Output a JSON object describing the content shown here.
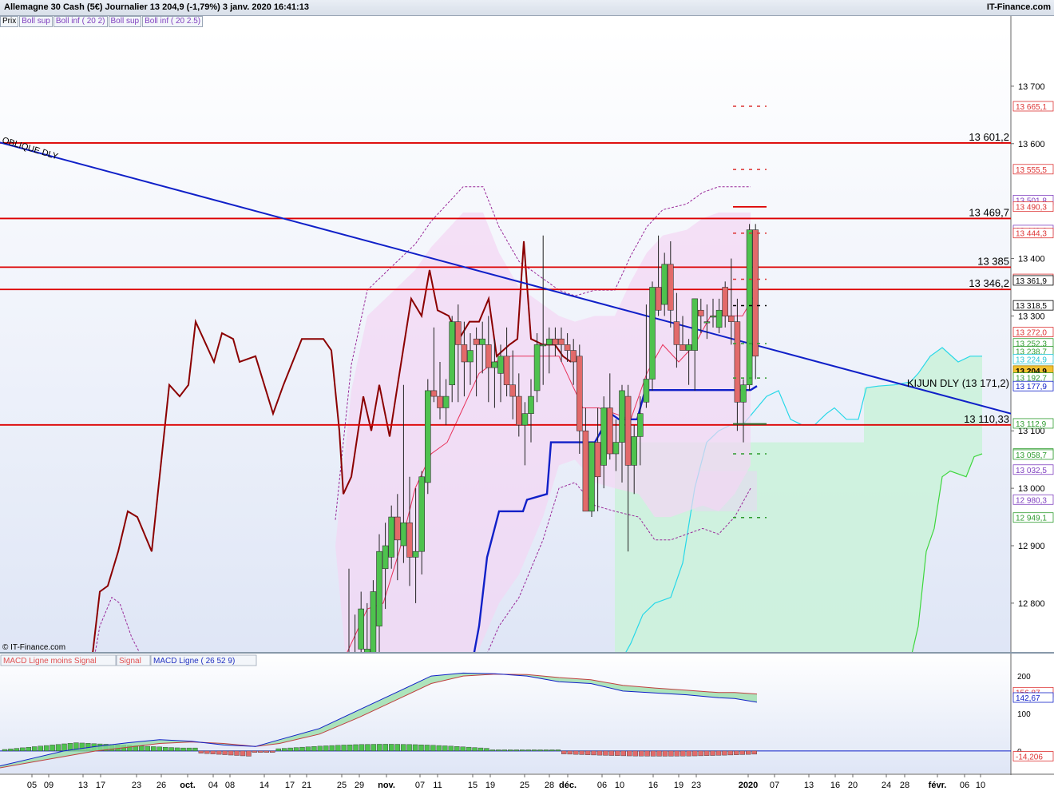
{
  "header": {
    "title": "Allemagne 30 Cash (5€)   Journalier   13 204,9 (-1,79%)   3 janv. 2020 16:41:13",
    "brand": "IT-Finance.com"
  },
  "legend": [
    {
      "label": "Prix",
      "color": "#000000"
    },
    {
      "label": "Boll sup",
      "color": "#7f3fbf"
    },
    {
      "label": "Boll inf ( 20 2)",
      "color": "#7f3fbf"
    },
    {
      "label": "Boll sup",
      "color": "#7f3fbf"
    },
    {
      "label": "Boll inf ( 20 2.5)",
      "color": "#7f3fbf"
    }
  ],
  "watermark": "© IT-Finance.com",
  "macd_legend": [
    {
      "label": "MACD Ligne moins Signal",
      "color": "#e05050"
    },
    {
      "label": "Signal",
      "color": "#e05050"
    },
    {
      "label": "MACD Ligne ( 26 52 9)",
      "color": "#2030c0"
    }
  ],
  "colors": {
    "up": "#4ec24e",
    "down": "#e26a6a",
    "resistance": "#dd0000",
    "oblique": "#1020c8",
    "kijun": "#1020c8",
    "close_line": "#8b0000",
    "cloud_fill": "#ccf2dc",
    "boll_fill": "#f3d6f3"
  },
  "chart_data": [
    {
      "type": "candlestick",
      "title": "Allemagne 30 Cash (5€)",
      "ylim": [
        12715,
        13800
      ],
      "y_ticks": [
        "13 700",
        "13 600",
        "13 400",
        "13 300",
        "13 100",
        "13 000",
        "12 900",
        "12 800"
      ],
      "x_ticks": [
        "05",
        "09",
        "13",
        "17",
        "23",
        "26",
        "oct.",
        "04",
        "08",
        "14",
        "17",
        "21",
        "25",
        "29",
        "nov.",
        "07",
        "11",
        "15",
        "19",
        "25",
        "28",
        "déc.",
        "06",
        "10",
        "16",
        "19",
        "23",
        "2020",
        "07",
        "13",
        "16",
        "20",
        "24",
        "28",
        "févr.",
        "06",
        "10"
      ],
      "candles": [
        {
          "o": 12640,
          "h": 12860,
          "l": 12560,
          "c": 12700
        },
        {
          "o": 12680,
          "h": 12780,
          "l": 12580,
          "c": 12710
        },
        {
          "o": 12720,
          "h": 12820,
          "l": 12650,
          "c": 12790
        },
        {
          "o": 12710,
          "h": 12800,
          "l": 12640,
          "c": 12720
        },
        {
          "o": 12700,
          "h": 12840,
          "l": 12650,
          "c": 12820
        },
        {
          "o": 12760,
          "h": 12920,
          "l": 12700,
          "c": 12890
        },
        {
          "o": 12860,
          "h": 12940,
          "l": 12790,
          "c": 12900
        },
        {
          "o": 12880,
          "h": 12970,
          "l": 12860,
          "c": 12950
        },
        {
          "o": 12950,
          "h": 12990,
          "l": 12840,
          "c": 12910
        },
        {
          "o": 12900,
          "h": 13180,
          "l": 12870,
          "c": 12940
        },
        {
          "o": 12940,
          "h": 13020,
          "l": 12830,
          "c": 12880
        },
        {
          "o": 12880,
          "h": 13000,
          "l": 12800,
          "c": 12890
        },
        {
          "o": 12890,
          "h": 13030,
          "l": 12850,
          "c": 13020
        },
        {
          "o": 13010,
          "h": 13190,
          "l": 12990,
          "c": 13170
        },
        {
          "o": 13170,
          "h": 13280,
          "l": 13150,
          "c": 13160
        },
        {
          "o": 13160,
          "h": 13220,
          "l": 13120,
          "c": 13140
        },
        {
          "o": 13140,
          "h": 13190,
          "l": 13110,
          "c": 13160
        },
        {
          "o": 13180,
          "h": 13300,
          "l": 13150,
          "c": 13290
        },
        {
          "o": 13290,
          "h": 13320,
          "l": 13150,
          "c": 13250
        },
        {
          "o": 13250,
          "h": 13290,
          "l": 13160,
          "c": 13220
        },
        {
          "o": 13220,
          "h": 13270,
          "l": 13180,
          "c": 13240
        },
        {
          "o": 13260,
          "h": 13280,
          "l": 13160,
          "c": 13250
        },
        {
          "o": 13250,
          "h": 13290,
          "l": 13200,
          "c": 13260
        },
        {
          "o": 13250,
          "h": 13300,
          "l": 13150,
          "c": 13210
        },
        {
          "o": 13210,
          "h": 13260,
          "l": 13140,
          "c": 13220
        },
        {
          "o": 13200,
          "h": 13250,
          "l": 13150,
          "c": 13230
        },
        {
          "o": 13230,
          "h": 13280,
          "l": 13160,
          "c": 13180
        },
        {
          "o": 13180,
          "h": 13240,
          "l": 13120,
          "c": 13160
        },
        {
          "o": 13160,
          "h": 13200,
          "l": 13090,
          "c": 13110
        },
        {
          "o": 13110,
          "h": 13150,
          "l": 13040,
          "c": 13130
        },
        {
          "o": 13130,
          "h": 13190,
          "l": 13080,
          "c": 13160
        },
        {
          "o": 13170,
          "h": 13270,
          "l": 13150,
          "c": 13250
        },
        {
          "o": 13250,
          "h": 13440,
          "l": 13180,
          "c": 13250
        },
        {
          "o": 13250,
          "h": 13280,
          "l": 13200,
          "c": 13260
        },
        {
          "o": 13260,
          "h": 13280,
          "l": 13230,
          "c": 13250
        },
        {
          "o": 13260,
          "h": 13280,
          "l": 13220,
          "c": 13250
        },
        {
          "o": 13250,
          "h": 13270,
          "l": 13220,
          "c": 13240
        },
        {
          "o": 13240,
          "h": 13260,
          "l": 13180,
          "c": 13220
        },
        {
          "o": 13230,
          "h": 13250,
          "l": 13060,
          "c": 13100
        },
        {
          "o": 13100,
          "h": 13140,
          "l": 13000,
          "c": 12960
        },
        {
          "o": 12960,
          "h": 13050,
          "l": 12950,
          "c": 13080
        },
        {
          "o": 13080,
          "h": 13140,
          "l": 12960,
          "c": 13020
        },
        {
          "o": 13040,
          "h": 13160,
          "l": 13000,
          "c": 13140
        },
        {
          "o": 13140,
          "h": 13200,
          "l": 13050,
          "c": 13060
        },
        {
          "o": 13060,
          "h": 13120,
          "l": 13030,
          "c": 13080
        },
        {
          "o": 13080,
          "h": 13180,
          "l": 13010,
          "c": 13170
        },
        {
          "o": 13160,
          "h": 13180,
          "l": 12890,
          "c": 13040
        },
        {
          "o": 13040,
          "h": 13110,
          "l": 12990,
          "c": 13090
        },
        {
          "o": 13090,
          "h": 13160,
          "l": 13040,
          "c": 13130
        },
        {
          "o": 13150,
          "h": 13320,
          "l": 13140,
          "c": 13190
        },
        {
          "o": 13190,
          "h": 13360,
          "l": 13170,
          "c": 13350
        },
        {
          "o": 13350,
          "h": 13440,
          "l": 13300,
          "c": 13310
        },
        {
          "o": 13320,
          "h": 13410,
          "l": 13300,
          "c": 13390
        },
        {
          "o": 13390,
          "h": 13430,
          "l": 13280,
          "c": 13310
        },
        {
          "o": 13290,
          "h": 13340,
          "l": 13210,
          "c": 13250
        },
        {
          "o": 13250,
          "h": 13300,
          "l": 13240,
          "c": 13240
        },
        {
          "o": 13240,
          "h": 13260,
          "l": 13180,
          "c": 13250
        },
        {
          "o": 13240,
          "h": 13330,
          "l": 13170,
          "c": 13330
        },
        {
          "o": 13310,
          "h": 13330,
          "l": 13270,
          "c": 13300
        },
        {
          "o": 13290,
          "h": 13320,
          "l": 13260,
          "c": 13290
        },
        {
          "o": 13300,
          "h": 13330,
          "l": 13280,
          "c": 13300
        },
        {
          "o": 13280,
          "h": 13330,
          "l": 13270,
          "c": 13310
        },
        {
          "o": 13350,
          "h": 13360,
          "l": 13280,
          "c": 13300
        },
        {
          "o": 13300,
          "h": 13400,
          "l": 13250,
          "c": 13290
        },
        {
          "o": 13290,
          "h": 13330,
          "l": 13100,
          "c": 13150
        },
        {
          "o": 13150,
          "h": 13190,
          "l": 13080,
          "c": 13180
        },
        {
          "o": 13180,
          "h": 13460,
          "l": 13170,
          "c": 13450
        },
        {
          "o": 13450,
          "h": 13460,
          "l": 13190,
          "c": 13230
        }
      ],
      "resistance_levels": [
        {
          "value": 13601.2,
          "label": "13 601,2"
        },
        {
          "value": 13469.7,
          "label": "13 469,7"
        },
        {
          "value": 13385,
          "label": "13 385"
        },
        {
          "value": 13346.2,
          "label": "13 346,2"
        },
        {
          "value": 13110.33,
          "label": "13 110,33"
        }
      ],
      "annotations": {
        "oblique": "OBLIQUE DLY",
        "kijun": "KIJUN DLY (13 171,2)",
        "kijun_value": 13171.2
      },
      "right_labels": [
        {
          "value": 13665.1,
          "label": "13 665,1",
          "color": "#dd3333"
        },
        {
          "value": 13555.5,
          "label": "13 555,5",
          "color": "#dd3333"
        },
        {
          "value": 13501.8,
          "label": "13 501,8",
          "color": "#7f3fbf"
        },
        {
          "value": 13490.3,
          "label": "13 490,3",
          "color": "#dd3333"
        },
        {
          "value": 13449.6,
          "label": "13 449,6",
          "color": "#7f3fbf"
        },
        {
          "value": 13444.3,
          "label": "13 444,3",
          "color": "#dd3333"
        },
        {
          "value": 13364.5,
          "label": "13 364,5",
          "color": "#dd3333"
        },
        {
          "value": 13361.9,
          "label": "13 361,9",
          "color": "#000000"
        },
        {
          "value": 13318.5,
          "label": "13 318,5",
          "color": "#000000"
        },
        {
          "value": 13272.0,
          "label": "13 272,0",
          "color": "#dd3333"
        },
        {
          "value": 13252.3,
          "label": "13 252,3",
          "color": "#2e9c2e"
        },
        {
          "value": 13238.7,
          "label": "13 238,7",
          "color": "#2e9c2e"
        },
        {
          "value": 13224.9,
          "label": "13 224,9",
          "color": "#27c6d6"
        },
        {
          "value": 13204.9,
          "label": "13 204,9",
          "color": "#000000"
        },
        {
          "value": 13192.7,
          "label": "13 192,7",
          "color": "#2e9c2e"
        },
        {
          "value": 13177.9,
          "label": "13 177,9",
          "color": "#1020c8"
        },
        {
          "value": 13112.9,
          "label": "13 112,9",
          "color": "#2e9c2e"
        },
        {
          "value": 13060.5,
          "label": "13 060,5",
          "color": "#2e9c2e"
        },
        {
          "value": 13058.7,
          "label": "13 058,7",
          "color": "#2e9c2e"
        },
        {
          "value": 13032.5,
          "label": "13 032,5",
          "color": "#7f3fbf"
        },
        {
          "value": 12980.3,
          "label": "12 980,3",
          "color": "#7f3fbf"
        },
        {
          "value": 12949.1,
          "label": "12 949,1",
          "color": "#2e9c2e"
        }
      ]
    },
    {
      "type": "bar",
      "title": "MACD Ligne ( 26 52 9)",
      "ylim": [
        -60,
        260
      ],
      "y_ticks": [
        "200",
        "100",
        "0"
      ],
      "right_labels": [
        {
          "value": 156.87,
          "label": "156,87",
          "color": "#dd3333"
        },
        {
          "value": 142.67,
          "label": "142,67",
          "color": "#1020c8"
        },
        {
          "value": -14.206,
          "label": "-14,206",
          "color": "#dd3333"
        }
      ]
    }
  ]
}
